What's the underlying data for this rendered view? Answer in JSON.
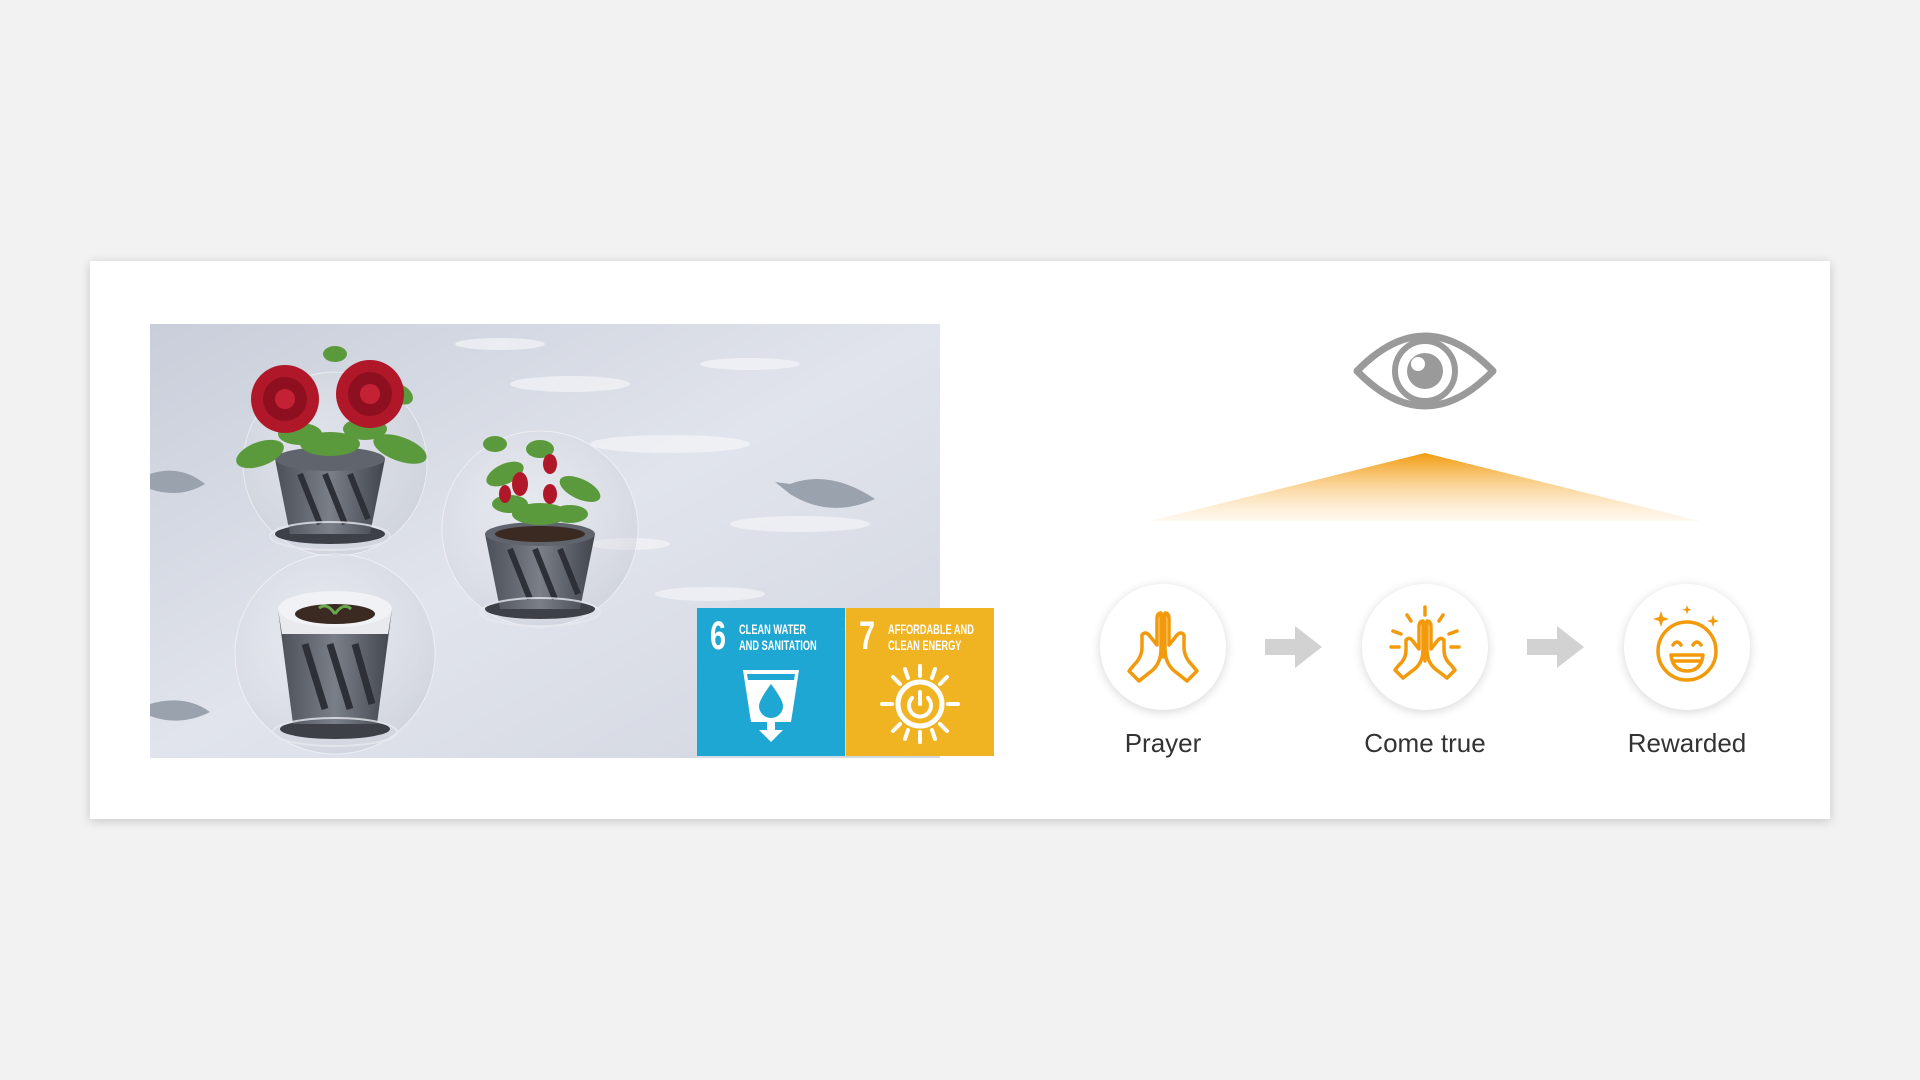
{
  "colors": {
    "accent": "#f29a0c",
    "sdg6": "#1ea7d2",
    "sdg7": "#f0b322",
    "arrow": "#d2d2d2",
    "eye": "#9a9a9a"
  },
  "sdg_tiles": [
    {
      "number": "6",
      "title": "CLEAN WATER\nAND SANITATION",
      "icon": "water-glass-icon"
    },
    {
      "number": "7",
      "title": "AFFORDABLE AND\nCLEAN ENERGY",
      "icon": "sun-power-icon"
    }
  ],
  "top_icon": "eye-icon",
  "steps": [
    {
      "label": "Prayer",
      "icon": "praying-hands-icon"
    },
    {
      "label": "Come true",
      "icon": "glowing-praying-hands-icon"
    },
    {
      "label": "Rewarded",
      "icon": "laughing-face-icon"
    }
  ]
}
